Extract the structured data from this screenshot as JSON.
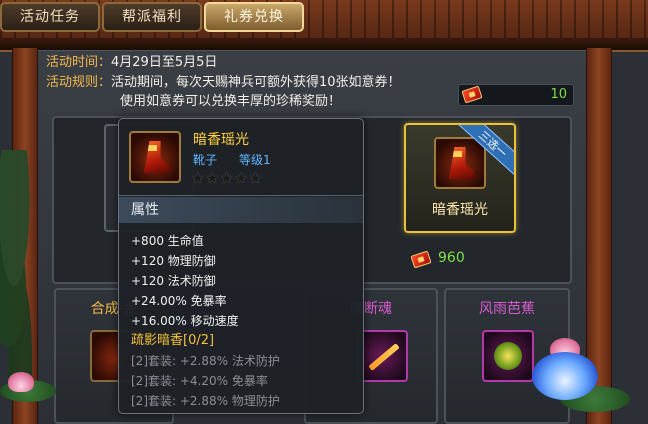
{
  "tabs": [
    {
      "label": "活动任务",
      "active": false
    },
    {
      "label": "帮派福利",
      "active": false
    },
    {
      "label": "礼券兑换",
      "active": true
    }
  ],
  "activity": {
    "time_label": "活动时间：",
    "time_value": "4月29日至5月5日",
    "rules_label": "活动规则：",
    "rules_line1": "活动期间，每次天赐神兵可额外获得10张如意券！",
    "rules_line2": "使用如意券可以兑换丰厚的珍稀奖励！"
  },
  "ticket_count": "10",
  "reward": {
    "name": "暗香瑶光",
    "banner": "三选一",
    "cost": "960"
  },
  "cards": [
    {
      "title": "合成·金"
    },
    {
      "title": "魄断魂"
    },
    {
      "title": "风雨芭蕉"
    }
  ],
  "tooltip": {
    "name": "暗香瑶光",
    "type": "靴子",
    "level": "等级1",
    "stars": "★★★★★",
    "section": "属性",
    "stats": [
      "+800 生命值",
      "+120 物理防御",
      "+120 法术防御",
      "+24.00% 免暴率",
      "+16.00% 移动速度"
    ],
    "set_title": "疏影暗香[0/2]",
    "set_bonuses": [
      "[2]套装: +2.88% 法术防护",
      "[2]套装: +4.20% 免暴率",
      "[2]套装: +2.88% 物理防护"
    ]
  },
  "colors": {
    "accent_gold": "#f4b94a",
    "counter_green": "#7de04a",
    "item_name_yellow": "#ffd23a",
    "item_type_blue": "#5fb6ff",
    "set_title": "#f3c23a",
    "inactive_set": "#8a8f96"
  },
  "icons": [
    "ticket-icon",
    "boots-icon",
    "gem-icon",
    "sword-icon",
    "lotus-decoration",
    "tree-decoration"
  ]
}
